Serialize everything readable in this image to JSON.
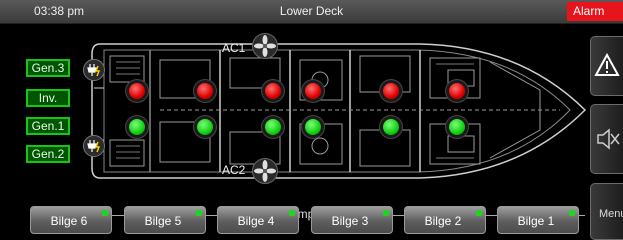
{
  "header": {
    "time": "03:38 pm",
    "title": "Lower Deck",
    "alarm": "Alarm"
  },
  "generators": [
    {
      "label": "Gen.3"
    },
    {
      "label": "Inv."
    },
    {
      "label": "Gen.1"
    },
    {
      "label": "Gen.2"
    }
  ],
  "ac_units": {
    "ac1": "AC1",
    "ac2": "AC2"
  },
  "pumps": {
    "section_label": "Pumps",
    "bilge_buttons": [
      {
        "label": "Bilge 6"
      },
      {
        "label": "Bilge 5"
      },
      {
        "label": "Bilge 4"
      },
      {
        "label": "Bilge 3"
      },
      {
        "label": "Bilge 2"
      },
      {
        "label": "Bilge 1"
      }
    ]
  },
  "side_menu": {
    "menu_label": "Menu"
  },
  "colors": {
    "alarm": "#e8141c",
    "ok": "#21d321",
    "fault": "#e00000",
    "gen_border": "#19c419"
  }
}
